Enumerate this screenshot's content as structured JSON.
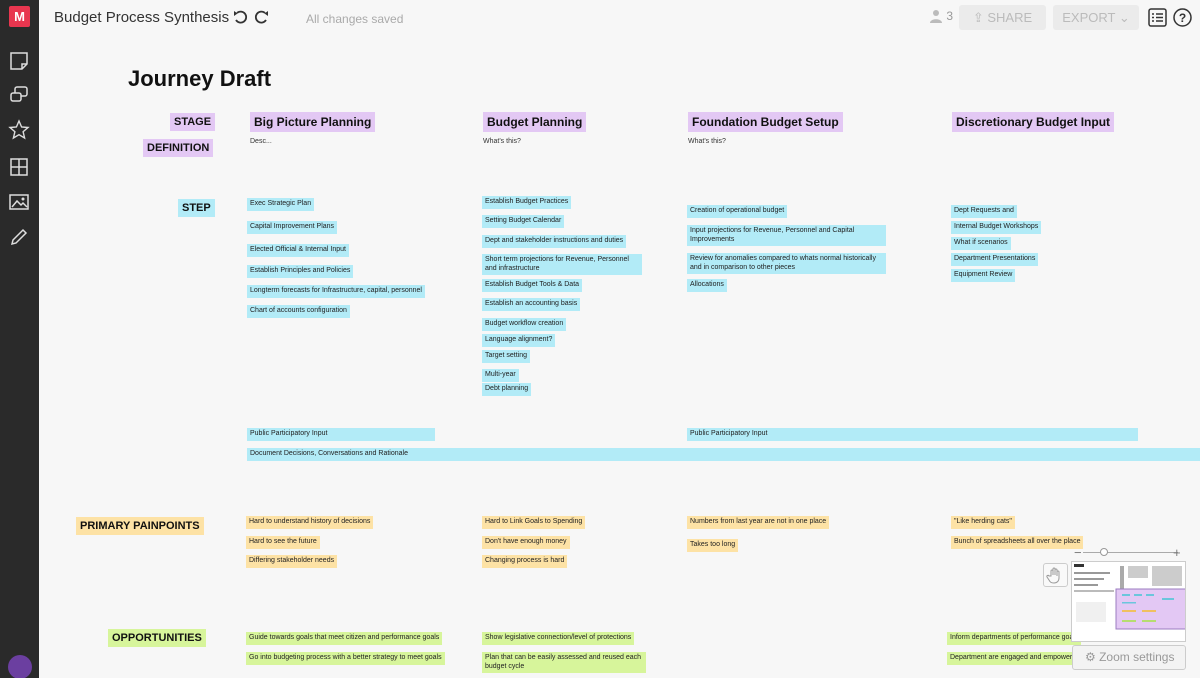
{
  "app": {
    "logo": "M",
    "title": "Budget Process Synthesis",
    "save_status": "All changes saved",
    "user_count": "3",
    "share": "SHARE",
    "export": "EXPORT"
  },
  "icons": {
    "undo": "undo-icon",
    "redo": "redo-icon",
    "outline": "list-icon",
    "help": "help-icon",
    "tools": [
      "sticky-note-icon",
      "comment-icon",
      "star-icon",
      "grid-icon",
      "image-icon",
      "pen-icon"
    ]
  },
  "canvas": {
    "title": "Journey Draft",
    "labels": {
      "stage": "STAGE",
      "definition": "DEFINITION",
      "step": "STEP",
      "painpoints": "PRIMARY PAINPOINTS",
      "opportunities": "OPPORTUNITIES"
    },
    "stages": [
      {
        "name": "Big Picture Planning",
        "desc": "Desc..."
      },
      {
        "name": "Budget Planning",
        "desc": "What's this?"
      },
      {
        "name": "Foundation Budget Setup",
        "desc": "What's this?"
      },
      {
        "name": "Discretionary Budget Input",
        "desc": ""
      }
    ],
    "steps": [
      [
        "Exec Strategic Plan",
        "Capital Improvement Plans",
        "Elected Official & Internal Input",
        "Establish Principles and Policies",
        "Longterm forecasts for Infrastructure, capital, personnel",
        "Chart of accounts configuration"
      ],
      [
        "Establish Budget Practices",
        "Setting Budget Calendar",
        "Dept and stakeholder instructions and duties",
        "Short term projections for Revenue, Personnel and infrastructure",
        "Establish Budget Tools & Data",
        "Establish an accounting basis",
        "Budget workflow creation",
        "Language alignment?",
        "Target setting",
        "Multi-year",
        "Debt planning"
      ],
      [
        "Creation of operational budget",
        "Input projections for Revenue, Personnel and Capital Improvements",
        "Review for anomalies compared to whats normal historically and in comparison to other pieces",
        "Allocations"
      ],
      [
        "Dept Requests and",
        "Internal Budget Workshops",
        "What if scenarios",
        "Department Presentations",
        "Equipment Review"
      ]
    ],
    "spanning": [
      "Public Participatory Input",
      "Public Participatory Input",
      "Document Decisions, Conversations and Rationale"
    ],
    "painpoints": [
      [
        "Hard to understand history of decisions",
        "Hard to see the future",
        "Differing stakeholder needs"
      ],
      [
        "Hard to Link Goals to Spending",
        "Don't have enough money",
        "Changing process is hard"
      ],
      [
        "Numbers from last year are not in one place",
        "Takes too long"
      ],
      [
        "\"Like herding cats\"",
        "Bunch of spreadsheets all over the place"
      ]
    ],
    "opportunities": [
      [
        "Guide towards goals that meet citizen and performance goals",
        "Go into budgeting process with a better strategy to meet goals"
      ],
      [
        "Show legislative connection/level of protections",
        "Plan that can be easily assessed and reused each budget cycle"
      ],
      [
        "Inform departments of performance goals",
        "Department are engaged and empowered"
      ]
    ]
  },
  "zoom": {
    "minus": "−",
    "plus": "+",
    "settings": "Zoom settings",
    "level": 0.25
  },
  "colors": {
    "stage": "#e3c8f4",
    "step": "#b2ebf7",
    "painpoint": "#fde2a5",
    "opportunity": "#d7f59b",
    "brand": "#e8364f"
  }
}
